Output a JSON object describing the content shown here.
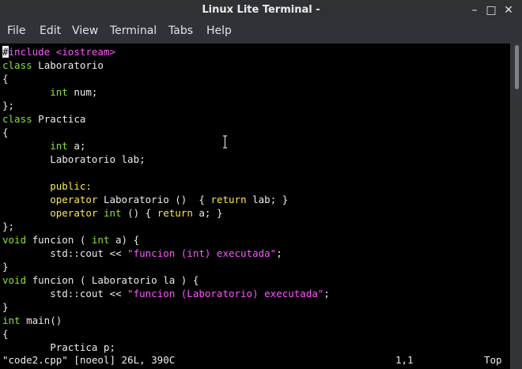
{
  "window": {
    "title": "Linux Lite Terminal -"
  },
  "menu": [
    "File",
    "Edit",
    "View",
    "Terminal",
    "Tabs",
    "Help"
  ],
  "palette": {
    "keyword": "#8ae234",
    "type": "#8ae234",
    "statement": "#fce94f",
    "string": "#ff55ff",
    "include": "#ff55ff",
    "text": "#ececec"
  },
  "code": [
    [
      {
        "t": "#",
        "c": "cursor"
      },
      {
        "t": "include ",
        "c": "include"
      },
      {
        "t": "<iostream>",
        "c": "string"
      }
    ],
    [
      {
        "t": "class",
        "c": "keyword"
      },
      {
        "t": " Laboratorio",
        "c": "text"
      }
    ],
    [
      {
        "t": "{",
        "c": "text"
      }
    ],
    [
      {
        "t": "        ",
        "c": "text"
      },
      {
        "t": "int",
        "c": "keyword"
      },
      {
        "t": " num;",
        "c": "text"
      }
    ],
    [
      {
        "t": "};",
        "c": "text"
      }
    ],
    [
      {
        "t": "class",
        "c": "keyword"
      },
      {
        "t": " Practica",
        "c": "text"
      }
    ],
    [
      {
        "t": "{",
        "c": "text"
      }
    ],
    [
      {
        "t": "        ",
        "c": "text"
      },
      {
        "t": "int",
        "c": "keyword"
      },
      {
        "t": " a;",
        "c": "text"
      }
    ],
    [
      {
        "t": "        Laboratorio lab;",
        "c": "text"
      }
    ],
    [
      {
        "t": "",
        "c": "text"
      }
    ],
    [
      {
        "t": "        ",
        "c": "text"
      },
      {
        "t": "public:",
        "c": "statement"
      }
    ],
    [
      {
        "t": "        ",
        "c": "text"
      },
      {
        "t": "operator",
        "c": "statement"
      },
      {
        "t": " Laboratorio ()  { ",
        "c": "text"
      },
      {
        "t": "return",
        "c": "statement"
      },
      {
        "t": " lab; }",
        "c": "text"
      }
    ],
    [
      {
        "t": "        ",
        "c": "text"
      },
      {
        "t": "operator",
        "c": "statement"
      },
      {
        "t": " ",
        "c": "text"
      },
      {
        "t": "int",
        "c": "keyword"
      },
      {
        "t": " () { ",
        "c": "text"
      },
      {
        "t": "return",
        "c": "statement"
      },
      {
        "t": " a; }",
        "c": "text"
      }
    ],
    [
      {
        "t": "};",
        "c": "text"
      }
    ],
    [
      {
        "t": "void",
        "c": "keyword"
      },
      {
        "t": " funcion ( ",
        "c": "text"
      },
      {
        "t": "int",
        "c": "keyword"
      },
      {
        "t": " a) {",
        "c": "text"
      }
    ],
    [
      {
        "t": "        std::cout << ",
        "c": "text"
      },
      {
        "t": "\"funcion (int) executada\"",
        "c": "string"
      },
      {
        "t": ";",
        "c": "text"
      }
    ],
    [
      {
        "t": "}",
        "c": "text"
      }
    ],
    [
      {
        "t": "void",
        "c": "keyword"
      },
      {
        "t": " funcion ( Laboratorio la ) {",
        "c": "text"
      }
    ],
    [
      {
        "t": "        std::cout << ",
        "c": "text"
      },
      {
        "t": "\"funcion (Laboratorio) executada\"",
        "c": "string"
      },
      {
        "t": ";",
        "c": "text"
      }
    ],
    [
      {
        "t": "}",
        "c": "text"
      }
    ],
    [
      {
        "t": "int",
        "c": "keyword"
      },
      {
        "t": " main()",
        "c": "text"
      }
    ],
    [
      {
        "t": "{",
        "c": "text"
      }
    ],
    [
      {
        "t": "        Practica p;",
        "c": "text"
      }
    ]
  ],
  "status": {
    "file": "\"code2.cpp\" [noeol] 26L, 390C",
    "pos": "1,1",
    "scroll": "Top"
  }
}
